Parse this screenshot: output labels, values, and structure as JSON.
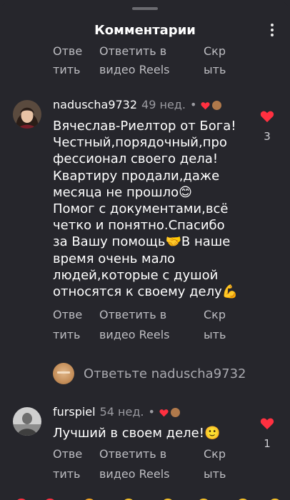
{
  "header": {
    "title": "Комментарии",
    "menu_icon": "more-vertical-icon"
  },
  "actions_labels": {
    "reply_1": "Отве",
    "reply_2": "тить",
    "video_1": "Ответить в",
    "video_2": "видео Reels",
    "hide_1": "Скр",
    "hide_2": "ыть"
  },
  "comments": [
    {
      "username": "naduscha9732",
      "time": "49 нед.",
      "dot": "•",
      "text": "Вячеслав-Риелтор от Бога!\nЧестный,порядочный,про\nфессионал своего дела!\nКвартиру продали,даже\nмесяца не прошло😊\nПомог с документами,всё\nчетко и понятно.Спасибо\nза Вашу помощь🤝В наше\nвремя очень мало\nлюдей,которые с душой\nотносятся к своему делу💪",
      "likes": "3"
    },
    {
      "username": "furspiel",
      "time": "54 нед.",
      "dot": "•",
      "text": "Лучший в своем деле!🙂",
      "likes": "1"
    }
  ],
  "reply_prompt": "Ответьте naduscha9732",
  "colors": {
    "background": "#26262c",
    "heart": "#ff3040",
    "muted": "#9a9aa0"
  }
}
